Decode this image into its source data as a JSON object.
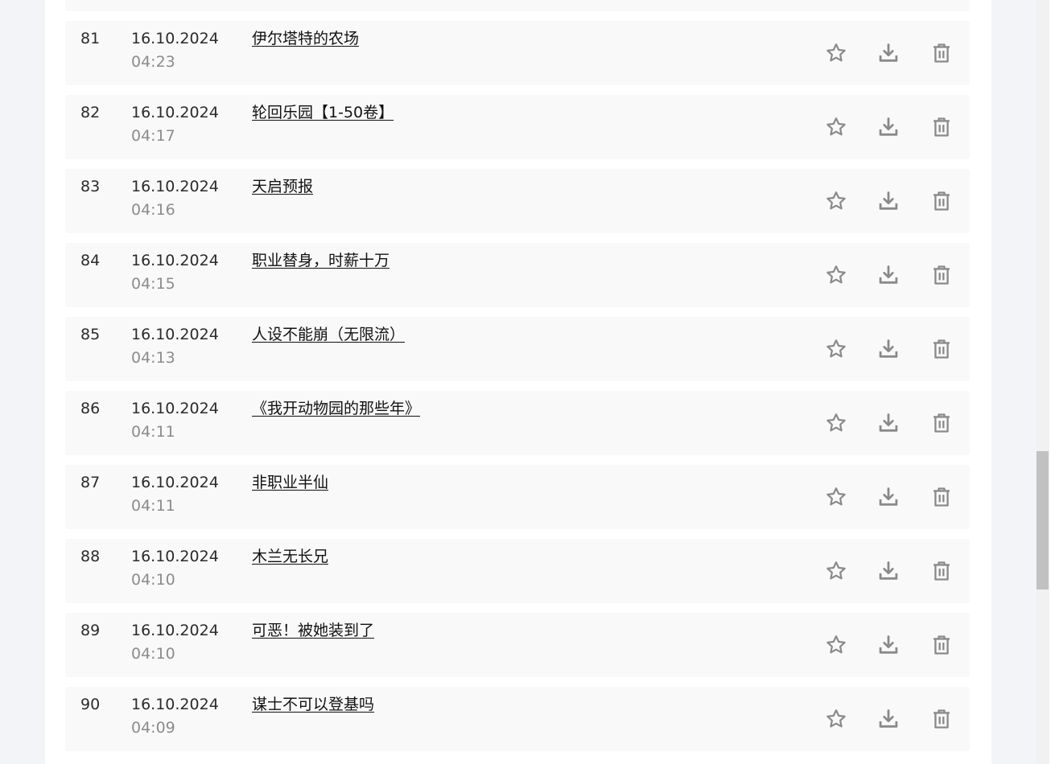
{
  "rows": [
    {
      "num": "81",
      "date": "16.10.2024",
      "time": "04:23",
      "title": "伊尔塔特的农场"
    },
    {
      "num": "82",
      "date": "16.10.2024",
      "time": "04:17",
      "title": "轮回乐园【1-50卷】"
    },
    {
      "num": "83",
      "date": "16.10.2024",
      "time": "04:16",
      "title": "天启预报"
    },
    {
      "num": "84",
      "date": "16.10.2024",
      "time": "04:15",
      "title": "职业替身，时薪十万"
    },
    {
      "num": "85",
      "date": "16.10.2024",
      "time": "04:13",
      "title": "人设不能崩（无限流）"
    },
    {
      "num": "86",
      "date": "16.10.2024",
      "time": "04:11",
      "title": "《我开动物园的那些年》"
    },
    {
      "num": "87",
      "date": "16.10.2024",
      "time": "04:11",
      "title": "非职业半仙"
    },
    {
      "num": "88",
      "date": "16.10.2024",
      "time": "04:10",
      "title": "木兰无长兄"
    },
    {
      "num": "89",
      "date": "16.10.2024",
      "time": "04:10",
      "title": "可恶！被她装到了"
    },
    {
      "num": "90",
      "date": "16.10.2024",
      "time": "04:09",
      "title": "谋士不可以登基吗"
    }
  ],
  "actions": [
    "star-icon",
    "download-icon",
    "delete-icon"
  ],
  "colors": {
    "row_background": "#f9f9f9",
    "icon": "#8a8a8a",
    "time_text": "#8c8c8c"
  }
}
